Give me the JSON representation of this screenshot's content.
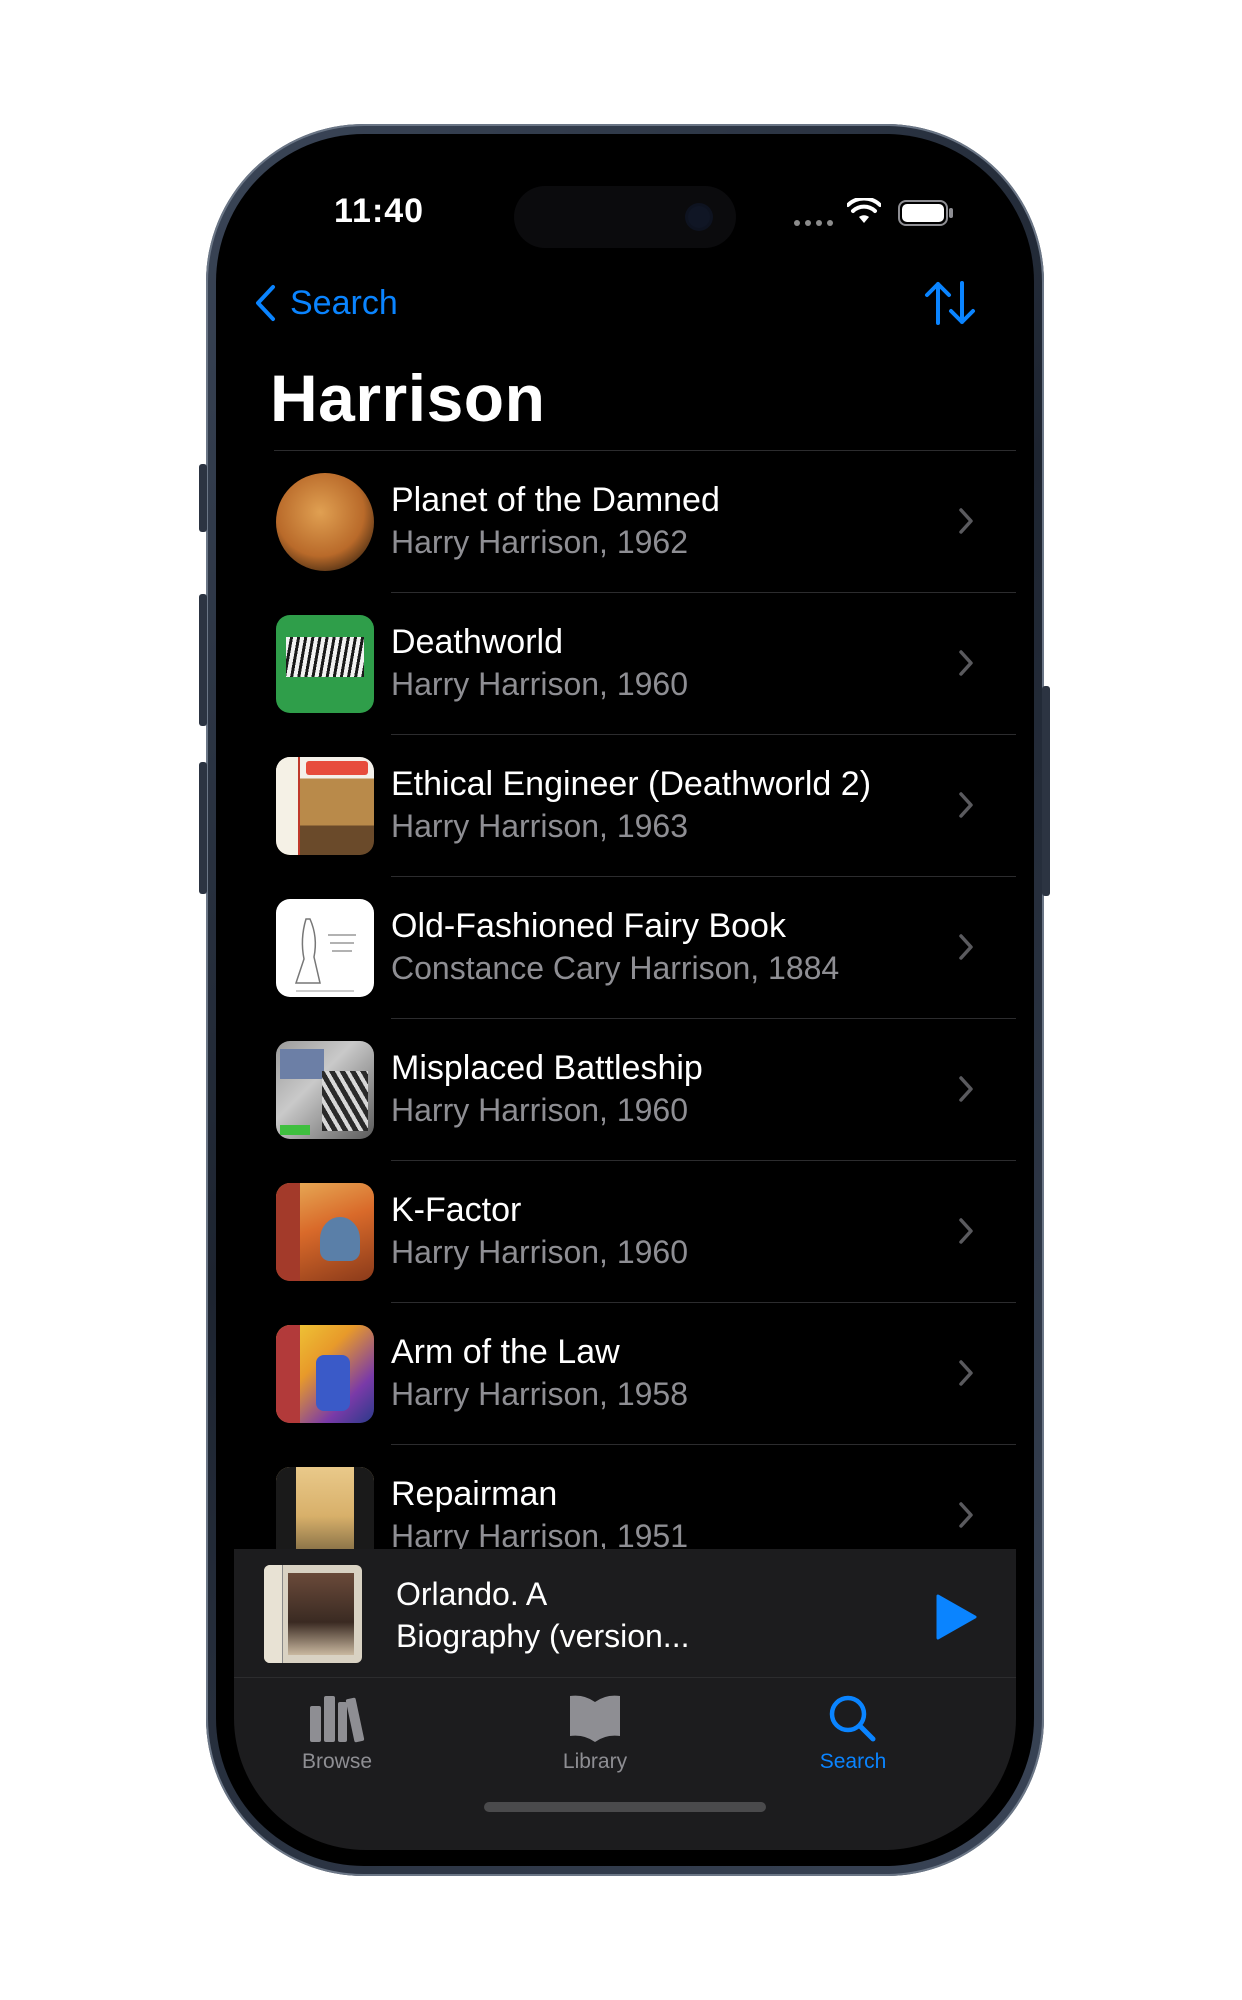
{
  "status_bar": {
    "time": "11:40",
    "icons": [
      "cellular-icon",
      "wifi-icon",
      "battery-icon"
    ]
  },
  "nav": {
    "back_label": "Search",
    "back_icon": "chevron-left-icon",
    "sort_icon": "sort-arrows-icon"
  },
  "page": {
    "title": "Harrison"
  },
  "books": [
    {
      "title": "Planet of the Damned",
      "subtitle": "Harry Harrison, 1962",
      "cover_icon": "planet-cover"
    },
    {
      "title": "Deathworld",
      "subtitle": "Harry Harrison, 1960",
      "cover_icon": "deathworld-cover"
    },
    {
      "title": "Ethical Engineer (Deathworld 2)",
      "subtitle": "Harry Harrison, 1963",
      "cover_icon": "analog-cover"
    },
    {
      "title": "Old-Fashioned Fairy Book",
      "subtitle": "Constance Cary Harrison, 1884",
      "cover_icon": "fairy-book-cover"
    },
    {
      "title": "Misplaced Battleship",
      "subtitle": "Harry Harrison, 1960",
      "cover_icon": "battleship-cover"
    },
    {
      "title": "K-Factor",
      "subtitle": "Harry Harrison, 1960",
      "cover_icon": "k-factor-cover"
    },
    {
      "title": "Arm of the Law",
      "subtitle": "Harry Harrison, 1958",
      "cover_icon": "arm-of-law-cover"
    },
    {
      "title": "Repairman",
      "subtitle": "Harry Harrison, 1951",
      "cover_icon": "repairman-cover"
    }
  ],
  "mini_player": {
    "title": "Orlando. A Biography (version...",
    "play_icon": "play-icon"
  },
  "tabs": [
    {
      "label": "Browse",
      "icon": "books-icon",
      "active": false
    },
    {
      "label": "Library",
      "icon": "open-book-icon",
      "active": false
    },
    {
      "label": "Search",
      "icon": "search-icon",
      "active": true
    }
  ],
  "colors": {
    "accent": "#0a84ff",
    "background": "#000000",
    "secondary_text": "#8e8e93",
    "tab_inactive": "#8e8e93"
  }
}
